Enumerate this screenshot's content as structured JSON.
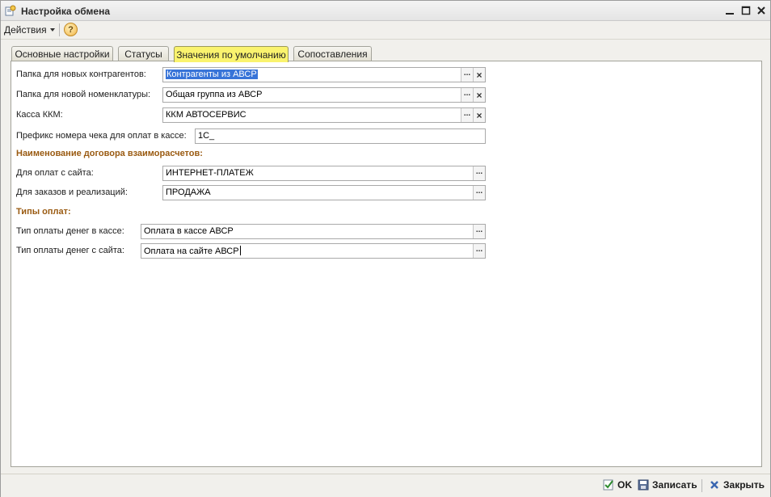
{
  "window": {
    "title": "Настройка обмена"
  },
  "toolbar": {
    "actions_label": "Действия",
    "help_label": "?"
  },
  "tabs": [
    {
      "label": "Основные настройки",
      "active": false
    },
    {
      "label": "Статусы",
      "active": false
    },
    {
      "label": "Значения по умолчанию",
      "active": true
    },
    {
      "label": "Сопоставления",
      "active": false
    }
  ],
  "form": {
    "new_contractors_folder": {
      "label": "Папка для новых контрагентов:",
      "value": "Контрагенты из АВСР"
    },
    "new_nomenclature_folder": {
      "label": "Папка для новой номенклатуры:",
      "value": "Общая группа из АВСР"
    },
    "kkm_cash": {
      "label": "Касса ККМ:",
      "value": "ККМ АВТОСЕРВИС"
    },
    "receipt_prefix": {
      "label": "Префикс номера чека для оплат в кассе:",
      "value": "1С_"
    },
    "contract_section": "Наименование договора взаиморасчетов:",
    "site_payments": {
      "label": "Для оплат с сайта:",
      "value": "ИНТЕРНЕТ-ПЛАТЕЖ"
    },
    "orders_sales": {
      "label": "Для заказов и реализаций:",
      "value": "ПРОДАЖА"
    },
    "payment_types_section": "Типы оплат:",
    "cash_payment_type": {
      "label": "Тип оплаты денег в кассе:",
      "value": "Оплата в кассе АВСР"
    },
    "site_payment_type": {
      "label": "Тип оплаты денег с сайта:",
      "value": "Оплата на сайте АВСР"
    }
  },
  "buttons": {
    "ok": "OK",
    "save": "Записать",
    "close": "Закрыть"
  },
  "colors": {
    "active_tab": "#faf36e",
    "section_heading": "#9a5b12",
    "selection": "#3874d8"
  }
}
